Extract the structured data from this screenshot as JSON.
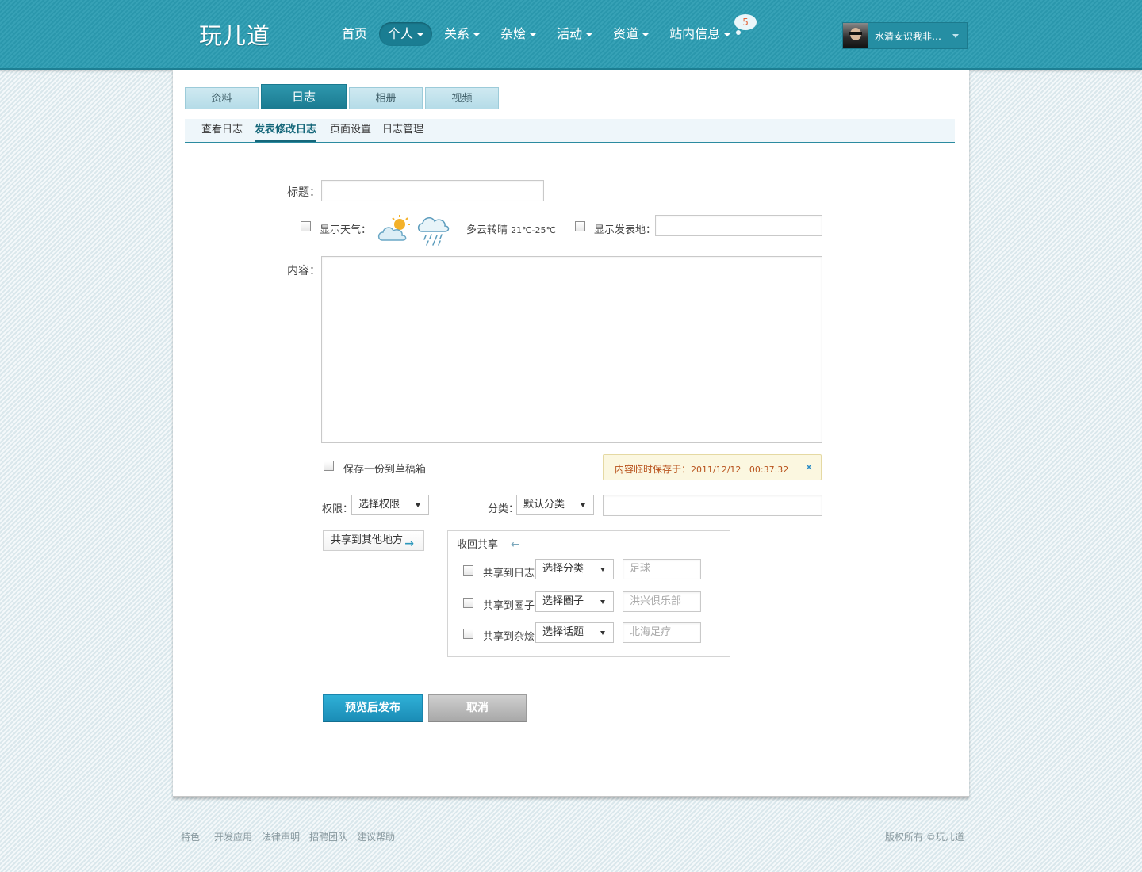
{
  "header": {
    "logo": "玩儿道",
    "nav": [
      {
        "label": "首页",
        "dropdown": false
      },
      {
        "label": "个人",
        "dropdown": true,
        "active": true
      },
      {
        "label": "关系",
        "dropdown": true
      },
      {
        "label": "杂烩",
        "dropdown": true
      },
      {
        "label": "活动",
        "dropdown": true
      },
      {
        "label": "资道",
        "dropdown": true
      },
      {
        "label": "站内信息",
        "dropdown": true,
        "badge": "5"
      }
    ],
    "user": {
      "name": "水清安识我非…"
    }
  },
  "tabs": [
    "资料",
    "日志",
    "相册",
    "视频"
  ],
  "active_tab": "日志",
  "subtabs": [
    "查看日志",
    "发表修改日志",
    "页面设置",
    "日志管理"
  ],
  "active_subtab": "发表修改日志",
  "form": {
    "title_label": "标题：",
    "title_value": "",
    "show_weather_label": "显示天气：",
    "weather_icons": [
      "partly-cloudy-icon",
      "rain-cloud-icon"
    ],
    "weather_text": "多云转晴",
    "temperature": "21℃-25℃",
    "show_location_label": "显示发表地：",
    "location_value": "",
    "content_label": "内容：",
    "content_value": "",
    "save_draft_label": "保存一份到草稿箱",
    "autosave": {
      "label": "内容临时保存于：",
      "datetime": "2011/12/12   00:37:32",
      "close": "×"
    },
    "permission_label": "权限：",
    "permission_select": "选择权限",
    "category_label": "分类：",
    "category_select": "默认分类",
    "category_input": "",
    "share_other_button": "共享到其他地方",
    "share_other_arrow": "→",
    "collapse_share": "收回共享",
    "collapse_arrow": "←",
    "share_rows": [
      {
        "label": "共享到日志",
        "select": "选择分类",
        "placeholder": "足球"
      },
      {
        "label": "共享到圈子",
        "select": "选择圈子",
        "placeholder": "洪兴俱乐部"
      },
      {
        "label": "共享到杂烩",
        "select": "选择话题",
        "placeholder": "北海足疗"
      }
    ],
    "publish_button": "预览后发布",
    "cancel_button": "取消"
  },
  "footer": {
    "links": [
      "特色",
      "开发应用",
      "法律声明",
      "招聘团队",
      "建议帮助"
    ],
    "copyright": "版权所有 ©玩儿道"
  },
  "colors": {
    "brand": "#2b9cb2",
    "accent": "#15677a",
    "primary_button": "#1b8db7",
    "notice_text": "#b8521c"
  }
}
